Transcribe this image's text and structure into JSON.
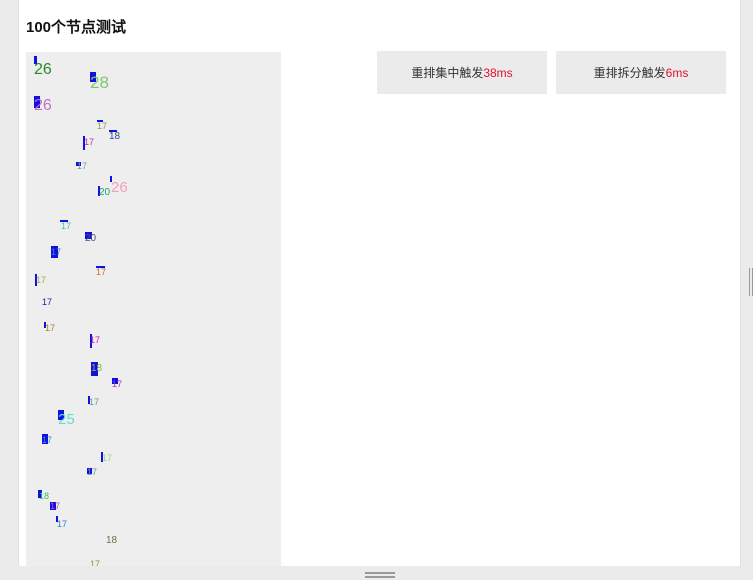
{
  "title": "100个节点测试",
  "buttons": {
    "concentrated": {
      "label": "重排集中触发",
      "ms": "38ms"
    },
    "split": {
      "label": "重排拆分触发",
      "ms": "6ms"
    }
  },
  "nodes": [
    {
      "t": "26",
      "c": "#2a8a2a"
    },
    {
      "t": "28",
      "c": "#7ac86a"
    },
    {
      "t": "26",
      "c": "#c070c8"
    },
    {
      "t": "17",
      "c": "#8a9a4a"
    },
    {
      "t": "18",
      "c": "#2a4a8a"
    },
    {
      "t": "17",
      "c": "#c0308a"
    },
    {
      "t": "17",
      "c": "#7aa0a0"
    },
    {
      "t": "26",
      "c": "#f0a0c0"
    },
    {
      "t": "20",
      "c": "#20a070"
    },
    {
      "t": "17",
      "c": "#40c0b0"
    },
    {
      "t": "20",
      "c": "#505080"
    },
    {
      "t": "17",
      "c": "#4080c0"
    },
    {
      "t": "17",
      "c": "#c07040"
    },
    {
      "t": "17",
      "c": "#a0b040"
    },
    {
      "t": "17",
      "c": "#2020a0"
    },
    {
      "t": "17",
      "c": "#b08020"
    },
    {
      "t": "17",
      "c": "#c020a0"
    },
    {
      "t": "18",
      "c": "#90b040"
    },
    {
      "t": "17",
      "c": "#a040c0"
    },
    {
      "t": "17",
      "c": "#60a080"
    },
    {
      "t": "25",
      "c": "#60e0d0"
    },
    {
      "t": "17",
      "c": "#4090c0"
    },
    {
      "t": "17",
      "c": "#a0d090"
    },
    {
      "t": "17",
      "c": "#60a0a0"
    },
    {
      "t": "18",
      "c": "#30c060"
    },
    {
      "t": "17",
      "c": "#c050c0"
    },
    {
      "t": "17",
      "c": "#3080d0"
    },
    {
      "t": "18",
      "c": "#707050"
    },
    {
      "t": "17",
      "c": "#909050"
    }
  ]
}
